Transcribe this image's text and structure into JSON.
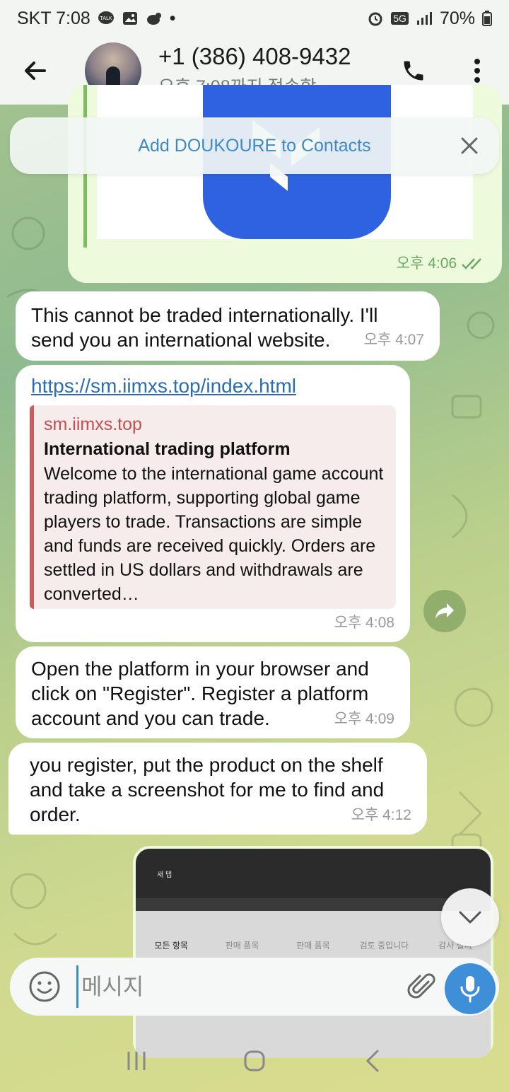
{
  "status_bar": {
    "carrier_time": "SKT 7:08",
    "network": "5G",
    "battery": "70%",
    "notification_dot": "•"
  },
  "header": {
    "contact_name": "+1 (386) 408-9432",
    "contact_status": "오후 7:08까지 접속함"
  },
  "banner": {
    "add_contact_label": "Add DOUKOURE to Contacts"
  },
  "messages": {
    "m0_time": "오후 4:06",
    "m1_text": "This cannot be traded internationally. I'll send you an international website.",
    "m1_time": "오후 4:07",
    "m2_link": "https://sm.iimxs.top/index.html",
    "m2_preview_site": "sm.iimxs.top",
    "m2_preview_title": "International trading platform",
    "m2_preview_desc": "Welcome to the international game account trading platform, supporting global game players to trade. Transactions are simple and funds are received quickly. Orders are settled in US dollars and withdrawals are converted…",
    "m2_time": "오후 4:08",
    "m3_text": "Open the platform in your browser and click on \"Register\". Register a platform account and you can trade.",
    "m3_time": "오후 4:09",
    "m4_text": "you register, put the product on the shelf and take a screenshot for me to find and order.",
    "m4_time": "오후 4:12",
    "m5_tabs": [
      "모든 항목",
      "판매 품목",
      "판매 품목",
      "검토 중입니다",
      "감사 실패"
    ],
    "m5_window_tab": "새 탭"
  },
  "composer": {
    "placeholder": "메시지"
  },
  "colors": {
    "accent_blue": "#3e8fd8",
    "link_blue": "#2a6db5",
    "outgoing_bubble": "#eefadc",
    "outgoing_time": "#6aa963",
    "preview_red": "#c24f4f",
    "app_logo_blue": "#2f62e0"
  },
  "icons": {
    "back": "arrow-left-icon",
    "call": "phone-icon",
    "menu": "more-vertical-icon",
    "close": "close-icon",
    "share": "share-forward-icon",
    "scroll": "chevron-down-icon",
    "emoji": "emoji-icon",
    "attach": "paperclip-icon",
    "mic": "microphone-icon"
  }
}
